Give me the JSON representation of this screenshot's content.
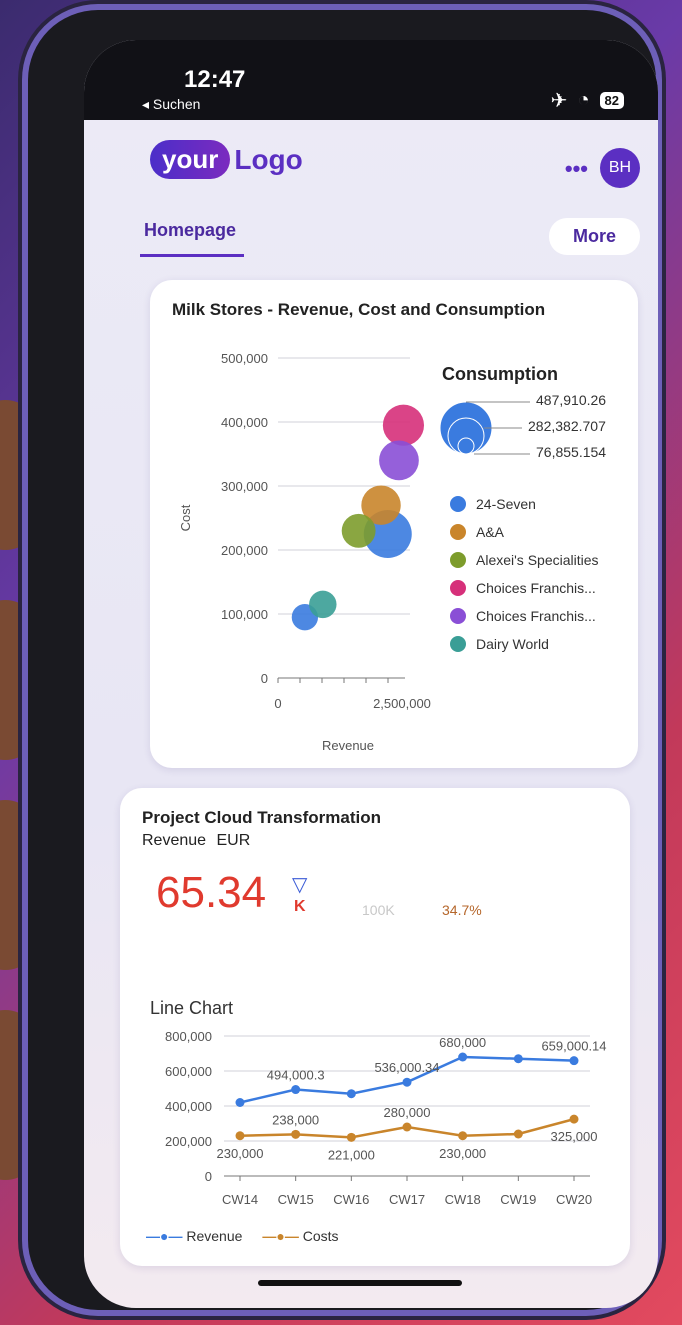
{
  "status_bar": {
    "time": "12:47",
    "back_label": "◂ Suchen",
    "battery": "82"
  },
  "header": {
    "logo_pill": "your",
    "logo_text": "Logo",
    "avatar_initials": "BH",
    "tab_home": "Homepage",
    "more_label": "More"
  },
  "card1": {
    "title": "Milk Stores - Revenue, Cost and Consumption",
    "consumption_title": "Consumption",
    "consumption_values": [
      "487,910.26",
      "282,382.707",
      "76,855.154"
    ],
    "legend": [
      {
        "name": "24-Seven",
        "color": "#3a7bdf"
      },
      {
        "name": "A&A",
        "color": "#c9852b"
      },
      {
        "name": "Alexei's Specialities",
        "color": "#7d9c2c"
      },
      {
        "name": "Choices Franchis...",
        "color": "#d6307a"
      },
      {
        "name": "Choices Franchis...",
        "color": "#8a4fd6"
      },
      {
        "name": "Dairy World",
        "color": "#3a9e96"
      }
    ],
    "chart_data": {
      "type": "scatter",
      "xlabel": "Revenue",
      "ylabel": "Cost",
      "y_ticks": [
        "500,000",
        "400,000",
        "300,000",
        "200,000",
        "100,000",
        "0"
      ],
      "x_ticks": [
        "0",
        "2,500,000"
      ],
      "xlim": [
        0,
        2500000
      ],
      "ylim": [
        0,
        500000
      ],
      "series": [
        {
          "name": "24-Seven",
          "points": [
            {
              "x": 2450000,
              "y": 225000,
              "size": 487910.26
            },
            {
              "x": 600000,
              "y": 95000,
              "size": 76855.154
            }
          ]
        },
        {
          "name": "A&A",
          "points": [
            {
              "x": 2300000,
              "y": 270000,
              "size": 282382.707
            }
          ]
        },
        {
          "name": "Alexei's Specialities",
          "points": [
            {
              "x": 1800000,
              "y": 230000,
              "size": 180000
            }
          ]
        },
        {
          "name": "Choices Franchis...",
          "points": [
            {
              "x": 2800000,
              "y": 395000,
              "size": 320000
            }
          ]
        },
        {
          "name": "Choices Franchis...",
          "points": [
            {
              "x": 2700000,
              "y": 340000,
              "size": 290000
            }
          ]
        },
        {
          "name": "Dairy World",
          "points": [
            {
              "x": 1000000,
              "y": 115000,
              "size": 90000
            }
          ]
        }
      ]
    }
  },
  "card2": {
    "title": "Project Cloud Transformation",
    "revenue_label": "Revenue",
    "currency": "EUR",
    "kpi_value": "65.34",
    "kpi_unit": "K",
    "target": "100K",
    "deviation": "34.7%",
    "line_chart_title": "Line Chart",
    "chart_data": {
      "type": "line",
      "categories": [
        "CW14",
        "CW15",
        "CW16",
        "CW17",
        "CW18",
        "CW19",
        "CW20"
      ],
      "y_ticks": [
        "800,000",
        "600,000",
        "400,000",
        "200,000",
        "0"
      ],
      "ylim": [
        0,
        800000
      ],
      "series": [
        {
          "name": "Revenue",
          "color": "#3a7bdf",
          "values": [
            420000,
            494000.3,
            470000,
            536000.34,
            680000,
            670000,
            659000.14
          ]
        },
        {
          "name": "Costs",
          "color": "#c9852b",
          "values": [
            230000,
            238000,
            221000,
            280000,
            230000,
            240000,
            325000
          ]
        }
      ],
      "labels": [
        {
          "text": "494,000.3",
          "series": 0,
          "index": 1
        },
        {
          "text": "536,000.34",
          "series": 0,
          "index": 3
        },
        {
          "text": "680,000",
          "series": 0,
          "index": 4
        },
        {
          "text": "659,000.14",
          "series": 0,
          "index": 6
        },
        {
          "text": "230,000",
          "series": 1,
          "index": 0
        },
        {
          "text": "238,000",
          "series": 1,
          "index": 1
        },
        {
          "text": "221,000",
          "series": 1,
          "index": 2
        },
        {
          "text": "280,000",
          "series": 1,
          "index": 3
        },
        {
          "text": "230,000",
          "series": 1,
          "index": 4
        },
        {
          "text": "325,000",
          "series": 1,
          "index": 6
        }
      ]
    }
  }
}
